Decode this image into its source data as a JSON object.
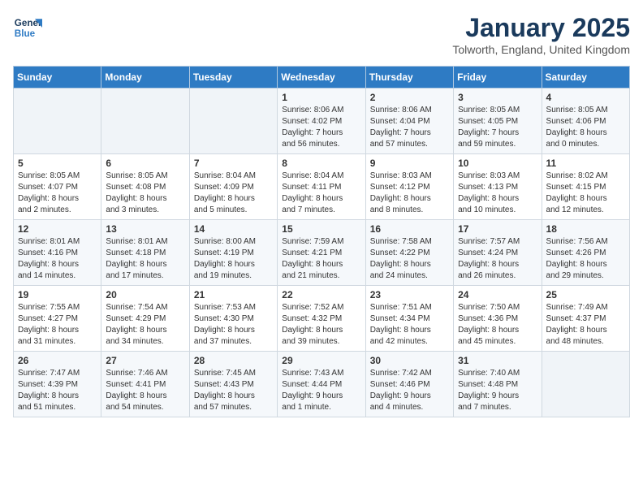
{
  "logo": {
    "line1": "General",
    "line2": "Blue"
  },
  "title": "January 2025",
  "location": "Tolworth, England, United Kingdom",
  "days_of_week": [
    "Sunday",
    "Monday",
    "Tuesday",
    "Wednesday",
    "Thursday",
    "Friday",
    "Saturday"
  ],
  "weeks": [
    [
      {
        "day": "",
        "info": ""
      },
      {
        "day": "",
        "info": ""
      },
      {
        "day": "",
        "info": ""
      },
      {
        "day": "1",
        "info": "Sunrise: 8:06 AM\nSunset: 4:02 PM\nDaylight: 7 hours\nand 56 minutes."
      },
      {
        "day": "2",
        "info": "Sunrise: 8:06 AM\nSunset: 4:04 PM\nDaylight: 7 hours\nand 57 minutes."
      },
      {
        "day": "3",
        "info": "Sunrise: 8:05 AM\nSunset: 4:05 PM\nDaylight: 7 hours\nand 59 minutes."
      },
      {
        "day": "4",
        "info": "Sunrise: 8:05 AM\nSunset: 4:06 PM\nDaylight: 8 hours\nand 0 minutes."
      }
    ],
    [
      {
        "day": "5",
        "info": "Sunrise: 8:05 AM\nSunset: 4:07 PM\nDaylight: 8 hours\nand 2 minutes."
      },
      {
        "day": "6",
        "info": "Sunrise: 8:05 AM\nSunset: 4:08 PM\nDaylight: 8 hours\nand 3 minutes."
      },
      {
        "day": "7",
        "info": "Sunrise: 8:04 AM\nSunset: 4:09 PM\nDaylight: 8 hours\nand 5 minutes."
      },
      {
        "day": "8",
        "info": "Sunrise: 8:04 AM\nSunset: 4:11 PM\nDaylight: 8 hours\nand 7 minutes."
      },
      {
        "day": "9",
        "info": "Sunrise: 8:03 AM\nSunset: 4:12 PM\nDaylight: 8 hours\nand 8 minutes."
      },
      {
        "day": "10",
        "info": "Sunrise: 8:03 AM\nSunset: 4:13 PM\nDaylight: 8 hours\nand 10 minutes."
      },
      {
        "day": "11",
        "info": "Sunrise: 8:02 AM\nSunset: 4:15 PM\nDaylight: 8 hours\nand 12 minutes."
      }
    ],
    [
      {
        "day": "12",
        "info": "Sunrise: 8:01 AM\nSunset: 4:16 PM\nDaylight: 8 hours\nand 14 minutes."
      },
      {
        "day": "13",
        "info": "Sunrise: 8:01 AM\nSunset: 4:18 PM\nDaylight: 8 hours\nand 17 minutes."
      },
      {
        "day": "14",
        "info": "Sunrise: 8:00 AM\nSunset: 4:19 PM\nDaylight: 8 hours\nand 19 minutes."
      },
      {
        "day": "15",
        "info": "Sunrise: 7:59 AM\nSunset: 4:21 PM\nDaylight: 8 hours\nand 21 minutes."
      },
      {
        "day": "16",
        "info": "Sunrise: 7:58 AM\nSunset: 4:22 PM\nDaylight: 8 hours\nand 24 minutes."
      },
      {
        "day": "17",
        "info": "Sunrise: 7:57 AM\nSunset: 4:24 PM\nDaylight: 8 hours\nand 26 minutes."
      },
      {
        "day": "18",
        "info": "Sunrise: 7:56 AM\nSunset: 4:26 PM\nDaylight: 8 hours\nand 29 minutes."
      }
    ],
    [
      {
        "day": "19",
        "info": "Sunrise: 7:55 AM\nSunset: 4:27 PM\nDaylight: 8 hours\nand 31 minutes."
      },
      {
        "day": "20",
        "info": "Sunrise: 7:54 AM\nSunset: 4:29 PM\nDaylight: 8 hours\nand 34 minutes."
      },
      {
        "day": "21",
        "info": "Sunrise: 7:53 AM\nSunset: 4:30 PM\nDaylight: 8 hours\nand 37 minutes."
      },
      {
        "day": "22",
        "info": "Sunrise: 7:52 AM\nSunset: 4:32 PM\nDaylight: 8 hours\nand 39 minutes."
      },
      {
        "day": "23",
        "info": "Sunrise: 7:51 AM\nSunset: 4:34 PM\nDaylight: 8 hours\nand 42 minutes."
      },
      {
        "day": "24",
        "info": "Sunrise: 7:50 AM\nSunset: 4:36 PM\nDaylight: 8 hours\nand 45 minutes."
      },
      {
        "day": "25",
        "info": "Sunrise: 7:49 AM\nSunset: 4:37 PM\nDaylight: 8 hours\nand 48 minutes."
      }
    ],
    [
      {
        "day": "26",
        "info": "Sunrise: 7:47 AM\nSunset: 4:39 PM\nDaylight: 8 hours\nand 51 minutes."
      },
      {
        "day": "27",
        "info": "Sunrise: 7:46 AM\nSunset: 4:41 PM\nDaylight: 8 hours\nand 54 minutes."
      },
      {
        "day": "28",
        "info": "Sunrise: 7:45 AM\nSunset: 4:43 PM\nDaylight: 8 hours\nand 57 minutes."
      },
      {
        "day": "29",
        "info": "Sunrise: 7:43 AM\nSunset: 4:44 PM\nDaylight: 9 hours\nand 1 minute."
      },
      {
        "day": "30",
        "info": "Sunrise: 7:42 AM\nSunset: 4:46 PM\nDaylight: 9 hours\nand 4 minutes."
      },
      {
        "day": "31",
        "info": "Sunrise: 7:40 AM\nSunset: 4:48 PM\nDaylight: 9 hours\nand 7 minutes."
      },
      {
        "day": "",
        "info": ""
      }
    ]
  ]
}
